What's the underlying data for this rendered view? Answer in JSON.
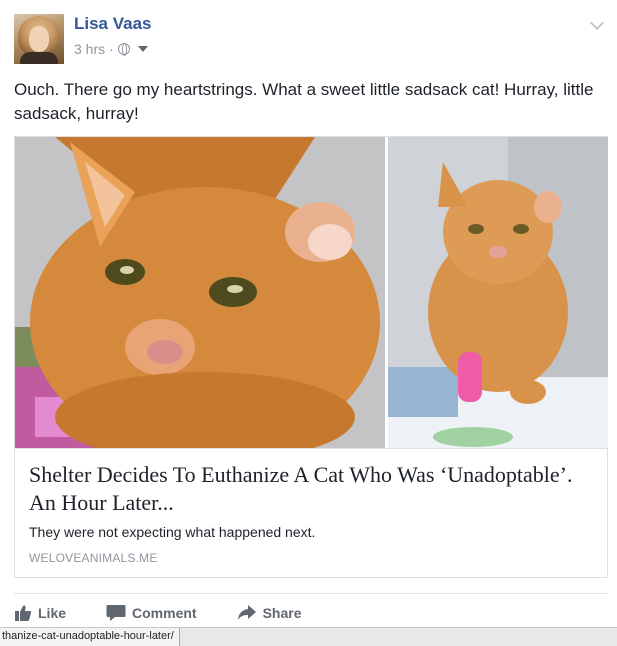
{
  "post": {
    "author": "Lisa Vaas",
    "time": "3 hrs",
    "separator": "·",
    "message": "Ouch. There go my heartstrings. What a sweet little sadsack cat! Hurray, little sadsack, hurray!"
  },
  "link": {
    "title": "Shelter Decides To Euthanize A Cat Who Was ‘Unadoptable’. An Hour Later...",
    "description": "They were not expecting what happened next.",
    "domain": "WELOVEANIMALS.ME"
  },
  "actions": {
    "like": "Like",
    "comment": "Comment",
    "share": "Share"
  },
  "status_bar": {
    "url": "thanize-cat-unadoptable-hour-later/"
  },
  "icons": {
    "privacy": "globe-icon",
    "audience": "caret-down-icon",
    "options": "chevron-down-icon",
    "like": "thumbs-up-icon",
    "comment": "speech-bubble-icon",
    "share": "share-arrow-icon"
  },
  "colors": {
    "author_link": "#365899",
    "meta_text": "#90949c",
    "action_text": "#606770",
    "body_text": "#1d2129"
  }
}
